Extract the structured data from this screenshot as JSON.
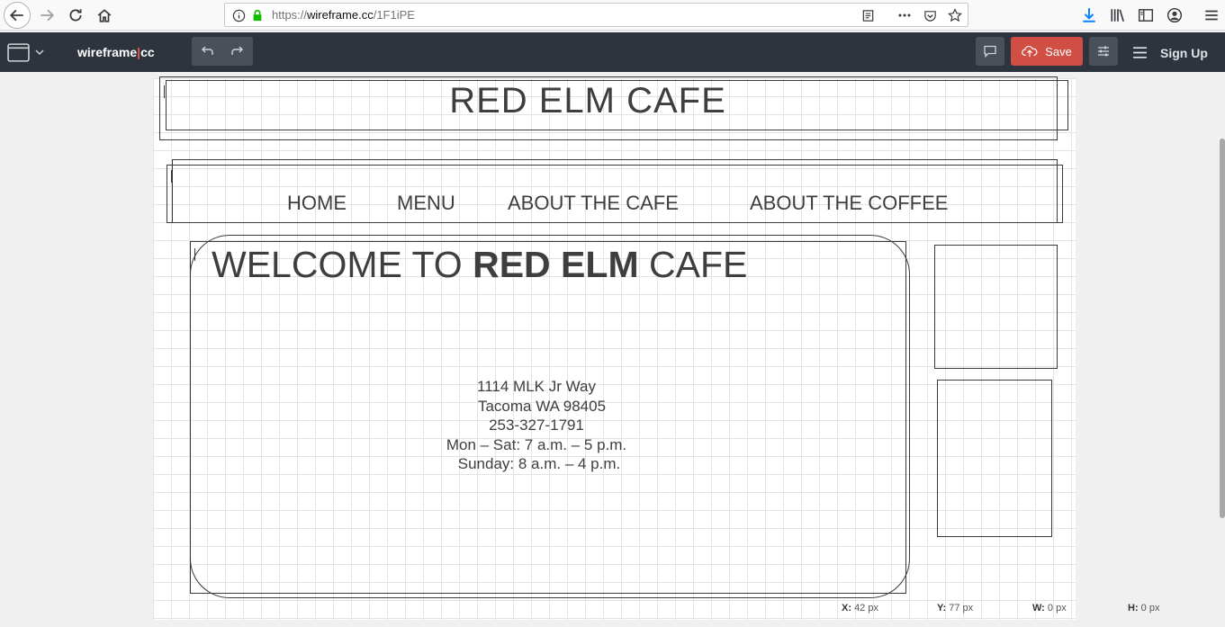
{
  "browser": {
    "url_prefix": "https://",
    "url_host": "wireframe.cc",
    "url_path": "/1F1iPE"
  },
  "app": {
    "logo_left": "wireframe",
    "logo_sep": "|",
    "logo_right": "cc",
    "save_label": "Save",
    "signup_label": "Sign Up"
  },
  "wireframe": {
    "header_title": "RED ELM CAFE",
    "nav": [
      "HOME",
      "MENU",
      "ABOUT THE CAFE",
      "ABOUT THE COFFEE"
    ],
    "welcome_prefix": "WELCOME TO ",
    "welcome_bold": "RED ELM",
    "welcome_suffix": " CAFE",
    "address_lines": [
      "1114 MLK Jr Way",
      "Tacoma WA 98405",
      "253-327-1791",
      "Mon – Sat: 7 a.m. – 5 p.m.",
      "Sunday: 8 a.m. – 4 p.m."
    ]
  },
  "status": {
    "x_label": "X:",
    "x_value": "42 px",
    "y_label": "Y:",
    "y_value": "77 px",
    "w_label": "W:",
    "w_value": "0 px",
    "h_label": "H:",
    "h_value": "0 px"
  }
}
